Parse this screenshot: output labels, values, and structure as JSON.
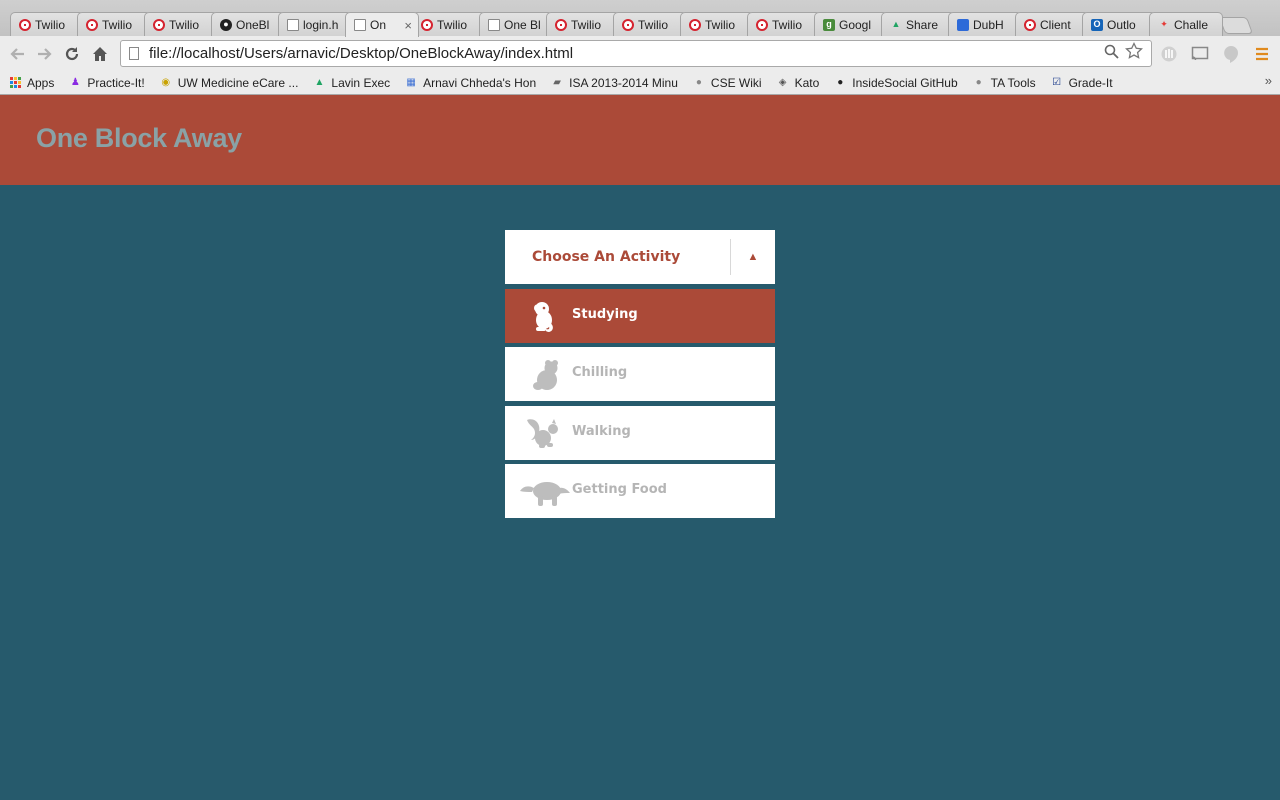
{
  "browser": {
    "tabs": [
      {
        "icon": "twilio",
        "title": "Twilio"
      },
      {
        "icon": "twilio",
        "title": "Twilio"
      },
      {
        "icon": "twilio",
        "title": "Twilio"
      },
      {
        "icon": "github",
        "title": "OneBl"
      },
      {
        "icon": "doc",
        "title": "login.h"
      },
      {
        "icon": "doc",
        "title": "On",
        "active": true
      },
      {
        "icon": "twilio",
        "title": "Twilio"
      },
      {
        "icon": "doc",
        "title": "One Bl"
      },
      {
        "icon": "twilio",
        "title": "Twilio"
      },
      {
        "icon": "twilio",
        "title": "Twilio"
      },
      {
        "icon": "twilio",
        "title": "Twilio"
      },
      {
        "icon": "twilio",
        "title": "Twilio"
      },
      {
        "icon": "google",
        "title": "Googl"
      },
      {
        "icon": "drive",
        "title": "Share"
      },
      {
        "icon": "dub",
        "title": "DubH"
      },
      {
        "icon": "twilio",
        "title": "Client"
      },
      {
        "icon": "outlook",
        "title": "Outlo"
      },
      {
        "icon": "challenge",
        "title": "Challe"
      }
    ],
    "tab_close_glyph": "×",
    "url": "file://localhost/Users/arnavic/Desktop/OneBlockAway/index.html",
    "bookmarks": [
      {
        "icon": "apps",
        "label": "Apps"
      },
      {
        "icon": "practice",
        "label": "Practice-It!"
      },
      {
        "icon": "uwmed",
        "label": "UW Medicine eCare ..."
      },
      {
        "icon": "drive",
        "label": "Lavin Exec"
      },
      {
        "icon": "calendar",
        "label": "Arnavi Chheda's Hon"
      },
      {
        "icon": "folder",
        "label": "ISA 2013-2014 Minu"
      },
      {
        "icon": "globe",
        "label": "CSE Wiki"
      },
      {
        "icon": "kato",
        "label": "Kato"
      },
      {
        "icon": "github",
        "label": "InsideSocial GitHub"
      },
      {
        "icon": "globe",
        "label": "TA Tools"
      },
      {
        "icon": "check",
        "label": "Grade-It"
      }
    ],
    "bookmarks_more": "»"
  },
  "site": {
    "title": "One Block Away"
  },
  "picker": {
    "label": "Choose An Activity",
    "arrow": "▲",
    "options": [
      {
        "label": "Studying",
        "icon": "monkey-icon",
        "selected": true
      },
      {
        "label": "Chilling",
        "icon": "bear-icon",
        "selected": false
      },
      {
        "label": "Walking",
        "icon": "squirrel-icon",
        "selected": false
      },
      {
        "label": "Getting Food",
        "icon": "anteater-icon",
        "selected": false
      }
    ]
  },
  "colors": {
    "brand_red": "#ab4a38",
    "page_bg": "#265a6c",
    "title_gray": "#8aa2a6",
    "muted_label": "#b5b5b5",
    "icon_gray": "#bdbdbd"
  }
}
